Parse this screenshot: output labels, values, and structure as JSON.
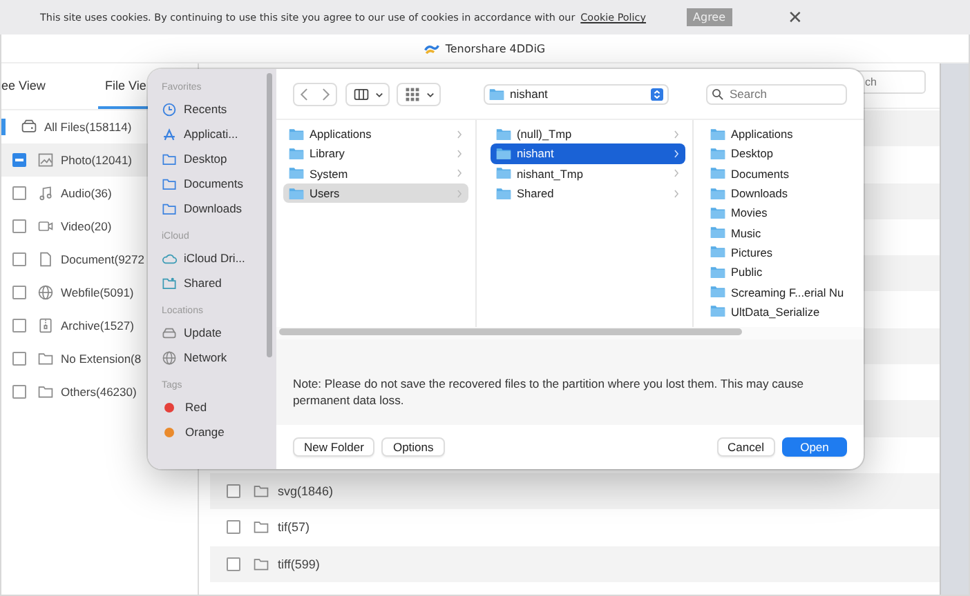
{
  "cookie_bar": {
    "message": "This site uses cookies. By continuing to use this site you agree to our use of cookies in accordance with our",
    "link": "Cookie Policy",
    "button": "Agree",
    "close": "✕"
  },
  "app": {
    "title": "Tenorshare 4DDiG"
  },
  "view_tabs": [
    {
      "label": "ee View",
      "selected": false
    },
    {
      "label": "File Vie",
      "selected": true
    }
  ],
  "categories": [
    {
      "label": "All Files(158114)",
      "kind": "drive",
      "selected": false
    },
    {
      "label": "Photo(12041)",
      "kind": "image",
      "indeterminate": true,
      "selected": true
    },
    {
      "label": "Audio(36)",
      "kind": "music",
      "checked": false,
      "selected": false
    },
    {
      "label": "Video(20)",
      "kind": "video",
      "checked": false,
      "selected": false
    },
    {
      "label": "Document(9272",
      "kind": "document",
      "checked": false,
      "selected": false
    },
    {
      "label": "Webfile(5091)",
      "kind": "globe",
      "checked": false,
      "selected": false
    },
    {
      "label": "Archive(1527)",
      "kind": "archive",
      "checked": false,
      "selected": false
    },
    {
      "label": "No Extension(8",
      "kind": "folder",
      "checked": false,
      "selected": false
    },
    {
      "label": "Others(46230)",
      "kind": "folder",
      "checked": false,
      "selected": false
    }
  ],
  "search": {
    "placeholder": "ch"
  },
  "file_rows": [
    {
      "label": "svg(1846)",
      "checked": false
    },
    {
      "label": "tif(57)",
      "checked": false
    },
    {
      "label": "tiff(599)",
      "checked": false
    }
  ],
  "dialog": {
    "sidebar": [
      {
        "heading": "Favorites",
        "items": [
          {
            "label": "Recents",
            "kind": "clock"
          },
          {
            "label": "Applicati...",
            "kind": "apps"
          },
          {
            "label": "Desktop",
            "kind": "folder"
          },
          {
            "label": "Documents",
            "kind": "folder"
          },
          {
            "label": "Downloads",
            "kind": "folder"
          }
        ]
      },
      {
        "heading": "iCloud",
        "items": [
          {
            "label": "iCloud Dri...",
            "kind": "cloud"
          },
          {
            "label": "Shared",
            "kind": "shared"
          }
        ]
      },
      {
        "heading": "Locations",
        "items": [
          {
            "label": "Update",
            "kind": "disk"
          },
          {
            "label": "Network",
            "kind": "globe"
          }
        ]
      },
      {
        "heading": "Tags",
        "items": [
          {
            "label": "Red",
            "kind": "tag",
            "color": "#e5413b"
          },
          {
            "label": "Orange",
            "kind": "tag",
            "color": "#ea8a2c"
          }
        ]
      }
    ],
    "path": "nishant",
    "search": {
      "placeholder": "Search"
    },
    "columns": [
      [
        {
          "label": "Applications",
          "selected": false,
          "expandable": true
        },
        {
          "label": "Library",
          "selected": false,
          "expandable": true
        },
        {
          "label": "System",
          "selected": false,
          "expandable": true
        },
        {
          "label": "Users",
          "selected": true,
          "expandable": true
        }
      ],
      [
        {
          "label": "(null)_Tmp",
          "selected": false,
          "expandable": true
        },
        {
          "label": "nishant",
          "selected": true,
          "expandable": true
        },
        {
          "label": "nishant_Tmp",
          "selected": false,
          "expandable": true
        },
        {
          "label": "Shared",
          "selected": false,
          "expandable": true
        }
      ],
      [
        {
          "label": "Applications",
          "selected": false,
          "expandable": false
        },
        {
          "label": "Desktop",
          "selected": false,
          "expandable": false
        },
        {
          "label": "Documents",
          "selected": false,
          "expandable": false
        },
        {
          "label": "Downloads",
          "selected": false,
          "expandable": false
        },
        {
          "label": "Movies",
          "selected": false,
          "expandable": false
        },
        {
          "label": "Music",
          "selected": false,
          "expandable": false
        },
        {
          "label": "Pictures",
          "selected": false,
          "expandable": false
        },
        {
          "label": "Public",
          "selected": false,
          "expandable": false
        },
        {
          "label": "Screaming F...erial Nu",
          "selected": false,
          "expandable": false
        },
        {
          "label": "UltData_Serialize",
          "selected": false,
          "expandable": false
        }
      ]
    ],
    "note": "Note: Please do not save the recovered files to the partition where you lost them. This may cause permanent data loss.",
    "buttons": [
      {
        "label": "New Folder",
        "kind": "left",
        "default": false
      },
      {
        "label": "Options",
        "kind": "left",
        "default": false
      },
      {
        "label": "Cancel",
        "kind": "right",
        "default": false
      },
      {
        "label": "Open",
        "kind": "right",
        "default": true
      }
    ]
  }
}
